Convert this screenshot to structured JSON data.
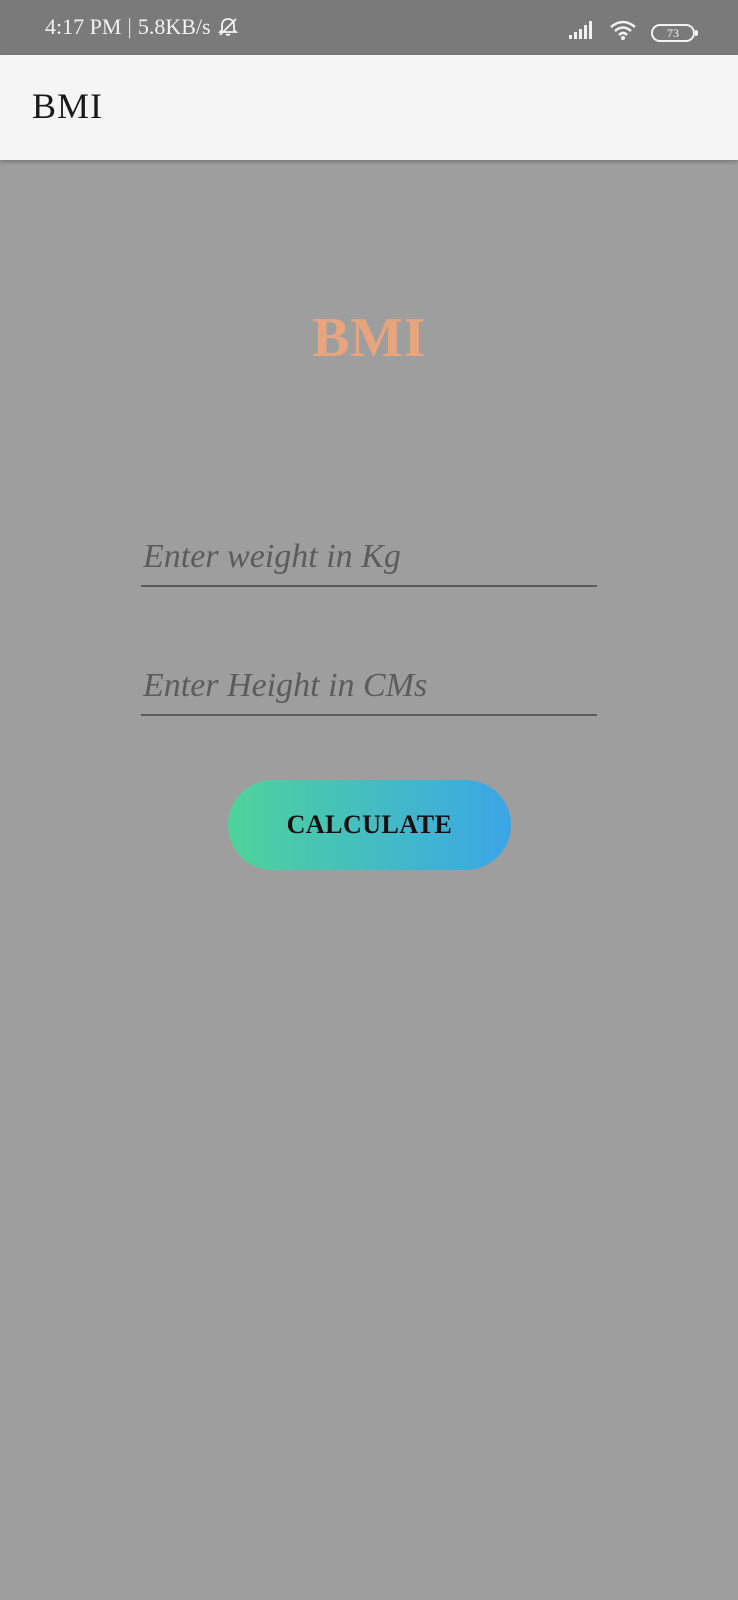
{
  "status_bar": {
    "time": "4:17 PM",
    "separator": "|",
    "speed": "5.8KB/s",
    "battery": "73",
    "icons": [
      "bell-off-icon",
      "signal-icon",
      "wifi-icon",
      "battery-icon"
    ]
  },
  "app_bar": {
    "title": "BMI"
  },
  "main": {
    "heading": "BMI",
    "weight_placeholder": "Enter weight in Kg",
    "height_placeholder": "Enter Height in CMs",
    "calculate_label": "CALCULATE"
  },
  "colors": {
    "status_bar": "#7a7a7a",
    "app_bar": "#f5f5f5",
    "background": "#9e9e9e",
    "heading": "#e8a57d",
    "button_gradient_start": "#4fd39a",
    "button_gradient_end": "#3aa6e8"
  }
}
